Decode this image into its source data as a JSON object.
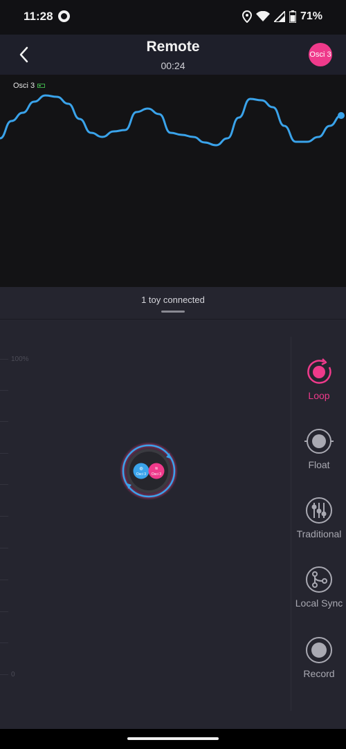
{
  "status_bar": {
    "time": "11:28",
    "battery": "71%",
    "icons": [
      "app-notification-icon",
      "location-icon",
      "wifi-icon",
      "signal-icon",
      "battery-icon"
    ]
  },
  "header": {
    "title": "Remote",
    "timer": "00:24",
    "toy_avatar": "Osci 3",
    "back_icon": "chevron-left-icon"
  },
  "graph": {
    "toy_label": "Osci 3",
    "line_color": "#3aa3ea",
    "points": [
      200,
      175,
      163,
      147,
      138,
      140,
      150,
      172,
      192,
      198,
      190,
      188,
      162,
      157,
      165,
      192,
      195,
      198,
      206,
      210,
      200,
      170,
      143,
      145,
      155,
      182,
      205,
      205,
      198,
      182,
      167
    ]
  },
  "panel": {
    "connected_text": "1 toy connected"
  },
  "controller": {
    "scale_max": "100%",
    "scale_min": "0",
    "dial_left_label": "Osci 3",
    "dial_right_label": "Osci 3"
  },
  "modes": [
    {
      "label": "Loop",
      "icon": "loop-icon",
      "active": true
    },
    {
      "label": "Float",
      "icon": "float-icon",
      "active": false
    },
    {
      "label": "Traditional",
      "icon": "sliders-icon",
      "active": false
    },
    {
      "label": "Local Sync",
      "icon": "sync-nodes-icon",
      "active": false
    },
    {
      "label": "Record",
      "icon": "record-icon",
      "active": false
    }
  ],
  "colors": {
    "accent": "#ef3a8b",
    "blue": "#3aa3ea",
    "panel_bg": "#25252f",
    "graph_bg": "#131315"
  }
}
